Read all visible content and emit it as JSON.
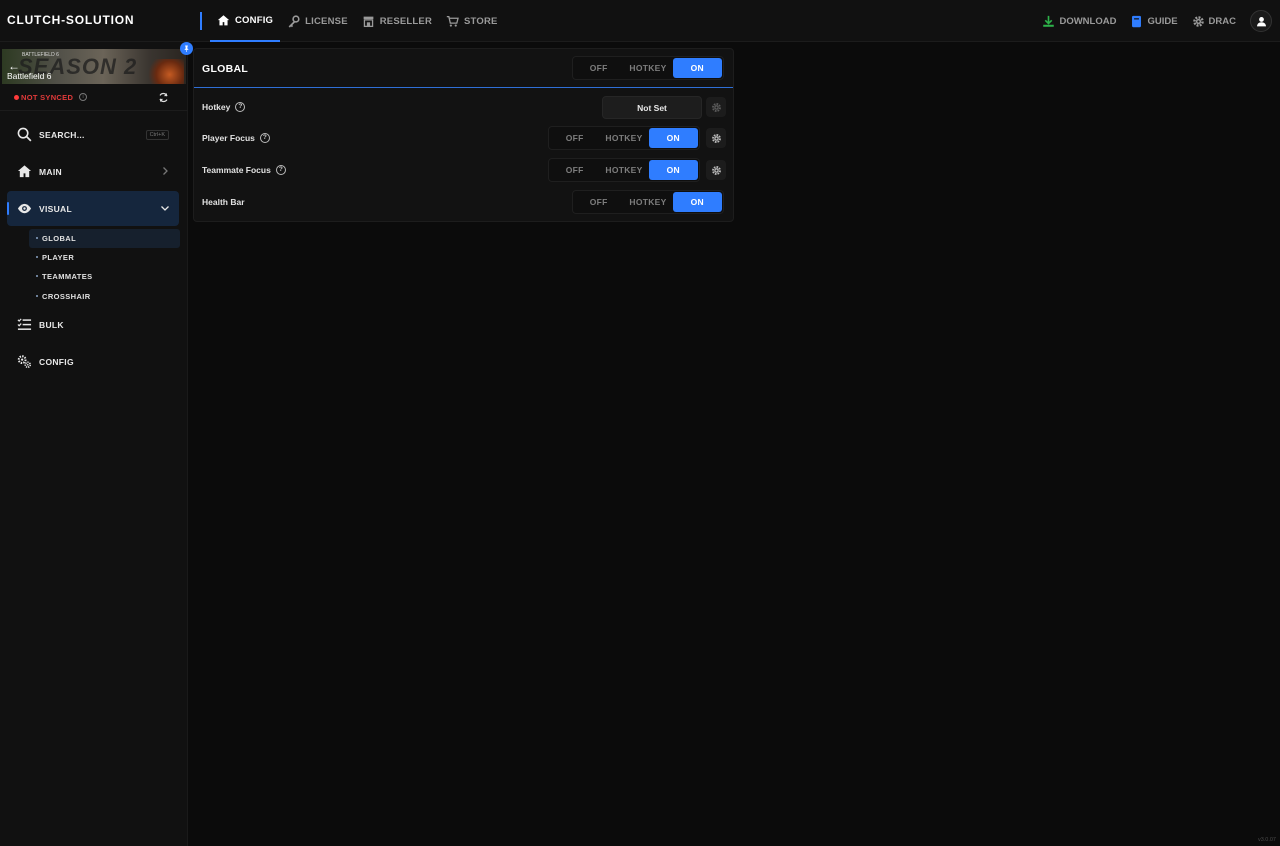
{
  "app": {
    "brand": "CLUTCH-SOLUTION",
    "version": "v3.0.07"
  },
  "topnav": {
    "items": [
      {
        "label": "CONFIG",
        "icon": "home-icon",
        "active": true
      },
      {
        "label": "LICENSE",
        "icon": "key-icon",
        "active": false
      },
      {
        "label": "RESELLER",
        "icon": "store-icon",
        "active": false
      },
      {
        "label": "STORE",
        "icon": "cart-icon",
        "active": false
      }
    ],
    "right": {
      "download": "DOWNLOAD",
      "guide": "GUIDE",
      "user": "DRAC"
    }
  },
  "sidebar": {
    "game": {
      "name": "Battlefield 6",
      "banner_text": "SEASON 2",
      "banner_small": "BATTLEFIELD 6"
    },
    "sync": {
      "status": "NOT SYNCED"
    },
    "search": {
      "label": "SEARCH...",
      "shortcut": "Ctrl+K"
    },
    "items": [
      {
        "label": "MAIN",
        "icon": "home-icon"
      },
      {
        "label": "VISUAL",
        "icon": "eye-icon",
        "active": true,
        "expanded": true
      },
      {
        "label": "BULK",
        "icon": "checklist-icon"
      },
      {
        "label": "CONFIG",
        "icon": "gears-icon"
      }
    ],
    "visual_sub": [
      "GLOBAL",
      "PLAYER",
      "TEAMMATES",
      "CROSSHAIR"
    ]
  },
  "panel": {
    "title": "GLOBAL",
    "title_toggle": {
      "options": [
        "OFF",
        "HOTKEY",
        "ON"
      ],
      "selected": "ON"
    },
    "rows": [
      {
        "label": "Hotkey",
        "help": "?",
        "value": "Not Set"
      },
      {
        "label": "Player Focus",
        "help": "?",
        "options": [
          "OFF",
          "HOTKEY",
          "ON"
        ],
        "selected": "ON"
      },
      {
        "label": "Teammate Focus",
        "help": "?",
        "options": [
          "OFF",
          "HOTKEY",
          "ON"
        ],
        "selected": "ON"
      },
      {
        "label": "Health Bar",
        "options": [
          "OFF",
          "HOTKEY",
          "ON"
        ],
        "selected": "ON"
      }
    ]
  },
  "colors": {
    "accent": "#2f7dff",
    "error": "#e23a3a",
    "bg": "#0b0b0b"
  }
}
